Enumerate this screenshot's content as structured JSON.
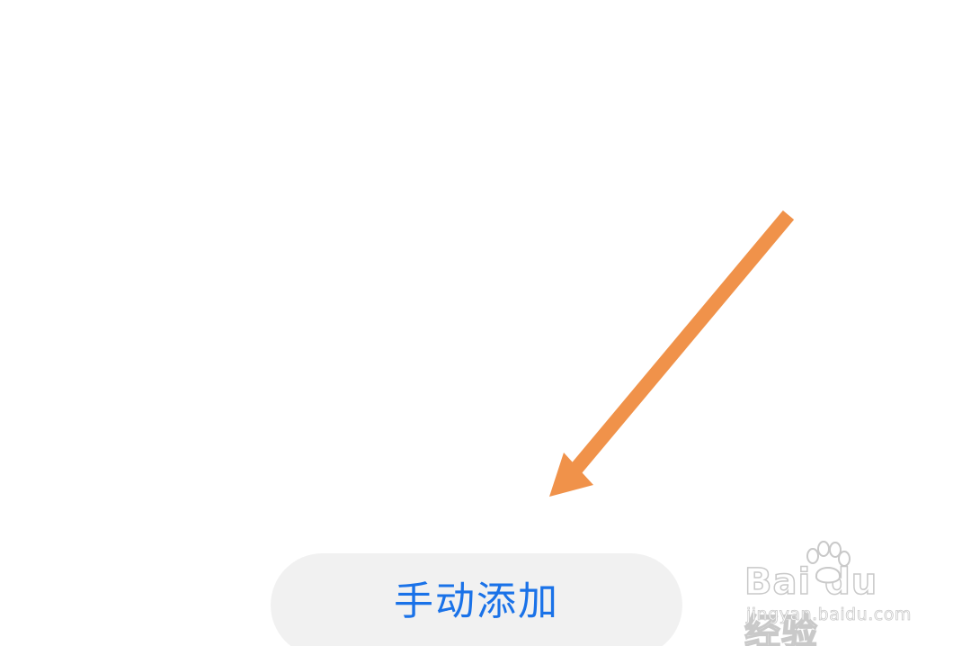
{
  "colors": {
    "background": "#ffffff",
    "button_background": "#f1f1f1",
    "button_text": "#1a72e8",
    "annotation_arrow": "#f0924a",
    "watermark_outline": "#c9c9c9"
  },
  "main": {
    "manual_add_label": "手动添加"
  },
  "annotation": {
    "icon": "arrow-icon"
  },
  "watermark": {
    "logo_text": "Bai  du 经验",
    "url": "jingyan.baidu.com"
  }
}
